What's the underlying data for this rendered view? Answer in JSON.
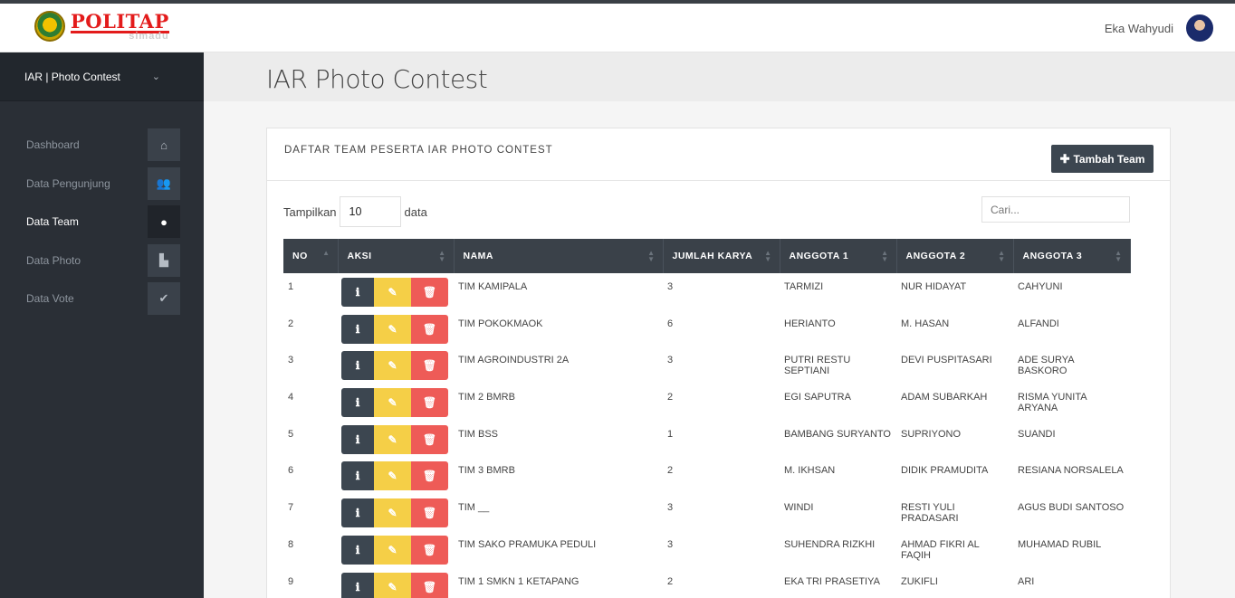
{
  "header": {
    "logo_text": "POLITAP",
    "logo_sub": "simadu",
    "user_name": "Eka Wahyudi"
  },
  "sidebar": {
    "title": "IAR | Photo Contest",
    "items": [
      {
        "label": "Dashboard",
        "icon": "home-icon",
        "glyph": "⌂"
      },
      {
        "label": "Data Pengunjung",
        "icon": "users-icon",
        "glyph": "👥"
      },
      {
        "label": "Data Team",
        "icon": "user-icon",
        "glyph": "●"
      },
      {
        "label": "Data Photo",
        "icon": "file-icon",
        "glyph": "▙"
      },
      {
        "label": "Data Vote",
        "icon": "check-icon",
        "glyph": "✔"
      }
    ]
  },
  "page": {
    "title": "IAR Photo Contest"
  },
  "panel": {
    "title": "DAFTAR TEAM PESERTA IAR PHOTO CONTEST",
    "add_button": "Tambah Team",
    "show_label": "Tampilkan",
    "show_value": "10",
    "show_suffix": "data",
    "search_placeholder": "Cari..."
  },
  "table": {
    "columns": [
      "NO",
      "AKSI",
      "NAMA",
      "JUMLAH KARYA",
      "ANGGOTA 1",
      "ANGGOTA 2",
      "ANGGOTA 3"
    ],
    "rows": [
      {
        "no": "1",
        "nama": "TIM KAMIPALA",
        "jumlah": "3",
        "a1": "TARMIZI",
        "a2": "NUR HIDAYAT",
        "a3": "CAHYUNI"
      },
      {
        "no": "2",
        "nama": "TIM POKOKMAOK",
        "jumlah": "6",
        "a1": "HERIANTO",
        "a2": "M. HASAN",
        "a3": "ALFANDI"
      },
      {
        "no": "3",
        "nama": "TIM AGROINDUSTRI 2A",
        "jumlah": "3",
        "a1": "PUTRI RESTU SEPTIANI",
        "a2": "DEVI PUSPITASARI",
        "a3": "ADE SURYA BASKORO"
      },
      {
        "no": "4",
        "nama": "TIM 2 BMRB",
        "jumlah": "2",
        "a1": "EGI SAPUTRA",
        "a2": "ADAM SUBARKAH",
        "a3": "RISMA YUNITA ARYANA"
      },
      {
        "no": "5",
        "nama": "TIM BSS",
        "jumlah": "1",
        "a1": "BAMBANG SURYANTO",
        "a2": "SUPRIYONO",
        "a3": "SUANDI"
      },
      {
        "no": "6",
        "nama": "TIM 3 BMRB",
        "jumlah": "2",
        "a1": "M. IKHSAN",
        "a2": "DIDIK PRAMUDITA",
        "a3": "RESIANA NORSALELA"
      },
      {
        "no": "7",
        "nama": "TIM __",
        "jumlah": "3",
        "a1": "WINDI",
        "a2": "RESTI YULI PRADASARI",
        "a3": "AGUS BUDI SANTOSO"
      },
      {
        "no": "8",
        "nama": "TIM SAKO PRAMUKA PEDULI",
        "jumlah": "3",
        "a1": "SUHENDRA RIZKHI",
        "a2": "AHMAD FIKRI AL FAQIH",
        "a3": "MUHAMAD RUBIL"
      },
      {
        "no": "9",
        "nama": "TIM 1 SMKN 1 KETAPANG",
        "jumlah": "2",
        "a1": "EKA TRI PRASETIYA",
        "a2": "ZUKIFLI",
        "a3": "ARI"
      }
    ]
  }
}
